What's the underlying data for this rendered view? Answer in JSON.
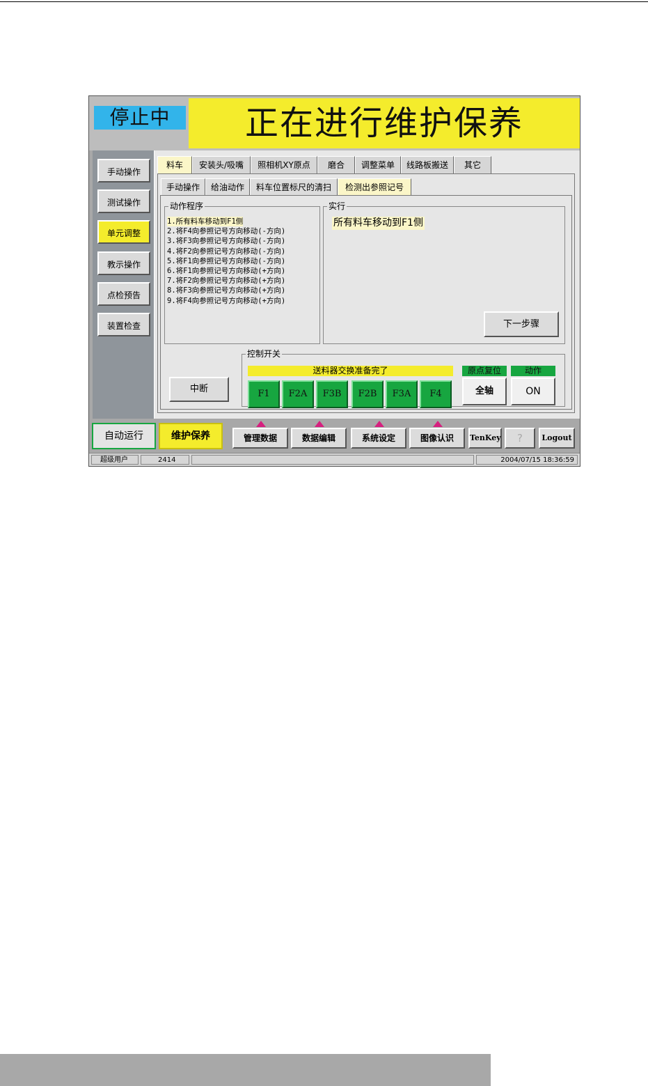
{
  "status": "停止中",
  "banner": "正在进行维护保养",
  "sidebar": {
    "items": [
      "手动操作",
      "测试操作",
      "单元调整",
      "教示操作",
      "点检预告",
      "装置检查"
    ],
    "active": "单元调整"
  },
  "tabs": [
    "料车",
    "安装头/吸嘴",
    "照相机XY原点",
    "磨合",
    "调整菜单",
    "线路板搬送",
    "其它"
  ],
  "active_tab": "料车",
  "subtabs": [
    "手动操作",
    "给油动作",
    "料车位置标尺的清扫",
    "检测出参照记号"
  ],
  "active_subtab": "检测出参照记号",
  "procedure": {
    "title": "动作程序",
    "steps": [
      "1.所有料车移动到F1侧",
      "2.将F4向参照记号方向移动(-方向)",
      "3.将F3向参照记号方向移动(-方向)",
      "4.将F2向参照记号方向移动(-方向)",
      "5.将F1向参照记号方向移动(-方向)",
      "6.将F1向参照记号方向移动(+方向)",
      "7.将F2向参照记号方向移动(+方向)",
      "8.将F3向参照记号方向移动(+方向)",
      "9.将F4向参照记号方向移动(+方向)"
    ]
  },
  "execute": {
    "title": "实行",
    "current": "所有料车移动到F1侧",
    "next_label": "下一步骤"
  },
  "interrupt_label": "中断",
  "control": {
    "title": "控制开关",
    "feeder_ready": "送料器交换准备完了",
    "feeders": [
      "F1",
      "F2A",
      "F3B",
      "F2B",
      "F3A",
      "F4"
    ],
    "home_title": "原点复位",
    "home_btn": "全轴",
    "action_title": "动作",
    "action_btn": "ON"
  },
  "modes": {
    "auto": "自动运行",
    "maint": "维护保养"
  },
  "nav": {
    "manage": "管理数据",
    "edit": "数据编辑",
    "system": "系统设定",
    "image": "图像认识",
    "tenkey": "TenKey",
    "help": "?",
    "logout": "Logout"
  },
  "statusbar": {
    "user": "超级用户",
    "code": "2414",
    "datetime": "2004/07/15 18:36:59"
  },
  "colors": {
    "banner": "#f4ec2c",
    "status": "#32b4ea",
    "green": "#17a640",
    "highlight": "#fbf6c8",
    "notch": "#d6207f"
  }
}
